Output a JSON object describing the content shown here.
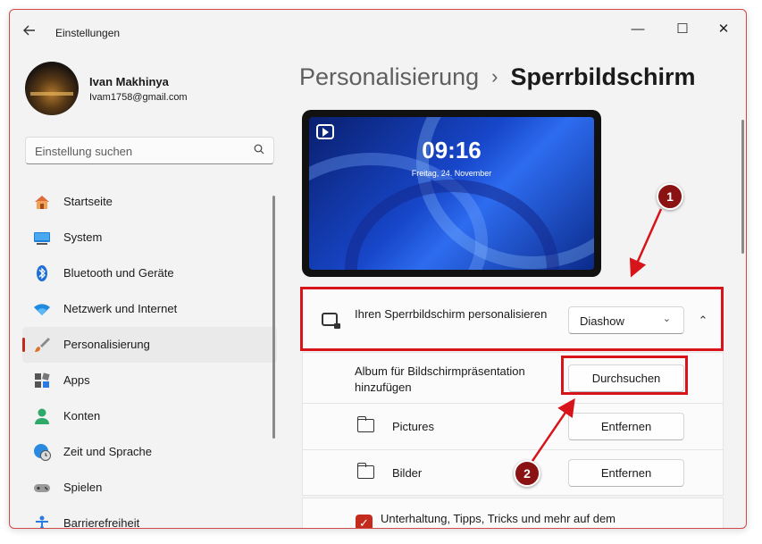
{
  "app": {
    "title": "Einstellungen",
    "back_icon": "arrow-left-icon",
    "minimize_glyph": "—",
    "maximize_glyph": "☐",
    "close_glyph": "✕"
  },
  "user": {
    "name": "Ivan Makhinya",
    "email": "Ivam1758@gmail.com"
  },
  "search": {
    "placeholder": "Einstellung suchen",
    "icon": "search-icon"
  },
  "sidebar": {
    "items": [
      {
        "label": "Startseite",
        "icon": "home-icon"
      },
      {
        "label": "System",
        "icon": "monitor-icon"
      },
      {
        "label": "Bluetooth und Geräte",
        "icon": "bluetooth-icon"
      },
      {
        "label": "Netzwerk und Internet",
        "icon": "wifi-icon"
      },
      {
        "label": "Personalisierung",
        "icon": "brush-icon",
        "active": true
      },
      {
        "label": "Apps",
        "icon": "apps-icon"
      },
      {
        "label": "Konten",
        "icon": "person-icon"
      },
      {
        "label": "Zeit und Sprache",
        "icon": "globe-clock-icon"
      },
      {
        "label": "Spielen",
        "icon": "gamepad-icon"
      },
      {
        "label": "Barrierefreiheit",
        "icon": "accessibility-icon"
      }
    ]
  },
  "breadcrumb": {
    "parent": "Personalisierung",
    "separator": "›",
    "current": "Sperrbildschirm"
  },
  "preview": {
    "time": "09:16",
    "date": "Freitag, 24. November",
    "play_icon": "slideshow-icon"
  },
  "lockscreen": {
    "label": "Ihren Sperrbildschirm personalisieren",
    "icon": "lock-screen-icon",
    "select_value": "Diashow",
    "chevron": "⌄",
    "collapse_glyph": "⌃"
  },
  "album": {
    "label": "Album für Bildschirmpräsentation hinzufügen",
    "button": "Durchsuchen"
  },
  "folders": [
    {
      "name": "Pictures",
      "button": "Entfernen",
      "icon": "folder-icon"
    },
    {
      "name": "Bilder",
      "button": "Entfernen",
      "icon": "folder-icon"
    }
  ],
  "tips": {
    "label": "Unterhaltung, Tipps, Tricks und mehr auf dem Sperrbildschirm",
    "checked": true,
    "check_glyph": "✓"
  },
  "annotations": [
    {
      "number": "1"
    },
    {
      "number": "2"
    }
  ],
  "colors": {
    "accent": "#c42b1c",
    "highlight": "#d8141b",
    "badge": "#8b1212"
  }
}
